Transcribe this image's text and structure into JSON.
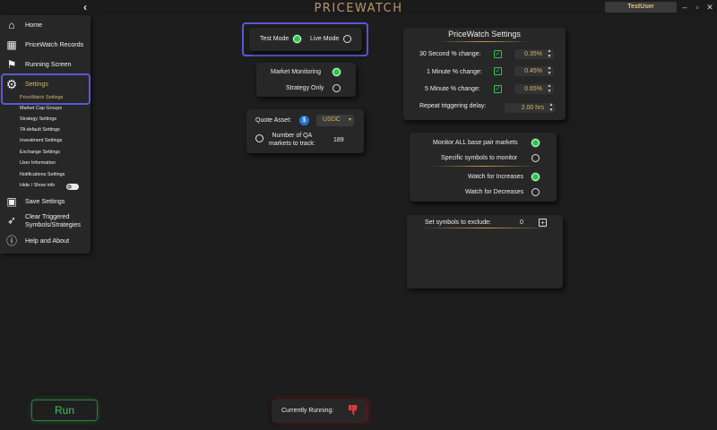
{
  "titlebar": {
    "app_title": "PRICEWATCH",
    "user": "TestUser",
    "back_icon": "chevron-left-icon",
    "minimize": "–",
    "maximize": "▫",
    "close": "✕"
  },
  "sidebar": {
    "items": [
      {
        "label": "Home",
        "icon": "home-icon",
        "glyph": "⌂"
      },
      {
        "label": "PriceWatch Records",
        "icon": "records-icon",
        "glyph": "▦"
      },
      {
        "label": "Running Screen",
        "icon": "runner-icon",
        "glyph": "⚑"
      },
      {
        "label": "Settings",
        "icon": "gear-icon",
        "glyph": "⚙"
      }
    ],
    "sub_items": [
      "PriceWatch Settings",
      "Market Cap Groups",
      "Strategy Settings",
      "TA default Settings",
      "Investment Settings",
      "Exchange Settings",
      "User Information",
      "Notifications Settings",
      "Hide / Show info"
    ],
    "bottom_items": [
      {
        "label": "Save Settings",
        "icon": "save-icon",
        "glyph": "▣"
      },
      {
        "label_line1": "Clear Triggered",
        "label_line2": "Symbols/Strategies",
        "icon": "rocket-icon",
        "glyph": "➶"
      },
      {
        "label": "Help and About",
        "icon": "info-icon",
        "glyph": "ⓘ"
      }
    ]
  },
  "mode": {
    "test_mode": "Test Mode",
    "live_mode": "Live Mode",
    "selected": "test"
  },
  "monitoring": {
    "market_monitoring": "Market Monitoring",
    "strategy_only": "Strategy Only",
    "selected": "market"
  },
  "quote": {
    "quote_asset_label": "Quote Asset:",
    "quote_asset_value": "USDC",
    "qa_label_line1": "Number of QA",
    "qa_label_line2": "markets to track:",
    "qa_value": "189"
  },
  "pricewatch_settings": {
    "title": "PriceWatch Settings",
    "rows": [
      {
        "label": "30 Second % change:",
        "value": "0.35%",
        "checked": true
      },
      {
        "label": "1 Minute % change:",
        "value": "0.45%",
        "checked": true
      },
      {
        "label": "5 Minute % change:",
        "value": "0.65%",
        "checked": true
      }
    ],
    "repeat_label": "Repeat triggering delay:",
    "repeat_value": "2.00 hrs"
  },
  "markets": {
    "monitor_all": "Monitor ALL base pair markets",
    "specific": "Specific symbols to monitor",
    "watch_increases": "Watch for Increases",
    "watch_decreases": "Watch for Decreases"
  },
  "exclude": {
    "label": "Set symbols to exclude:",
    "count": "0"
  },
  "run_button": "Run",
  "currently_running": "Currently Running:",
  "colors": {
    "accent": "#5b58d6",
    "gold": "#d8b568",
    "green": "#27c94a",
    "red": "#e03a3a"
  }
}
